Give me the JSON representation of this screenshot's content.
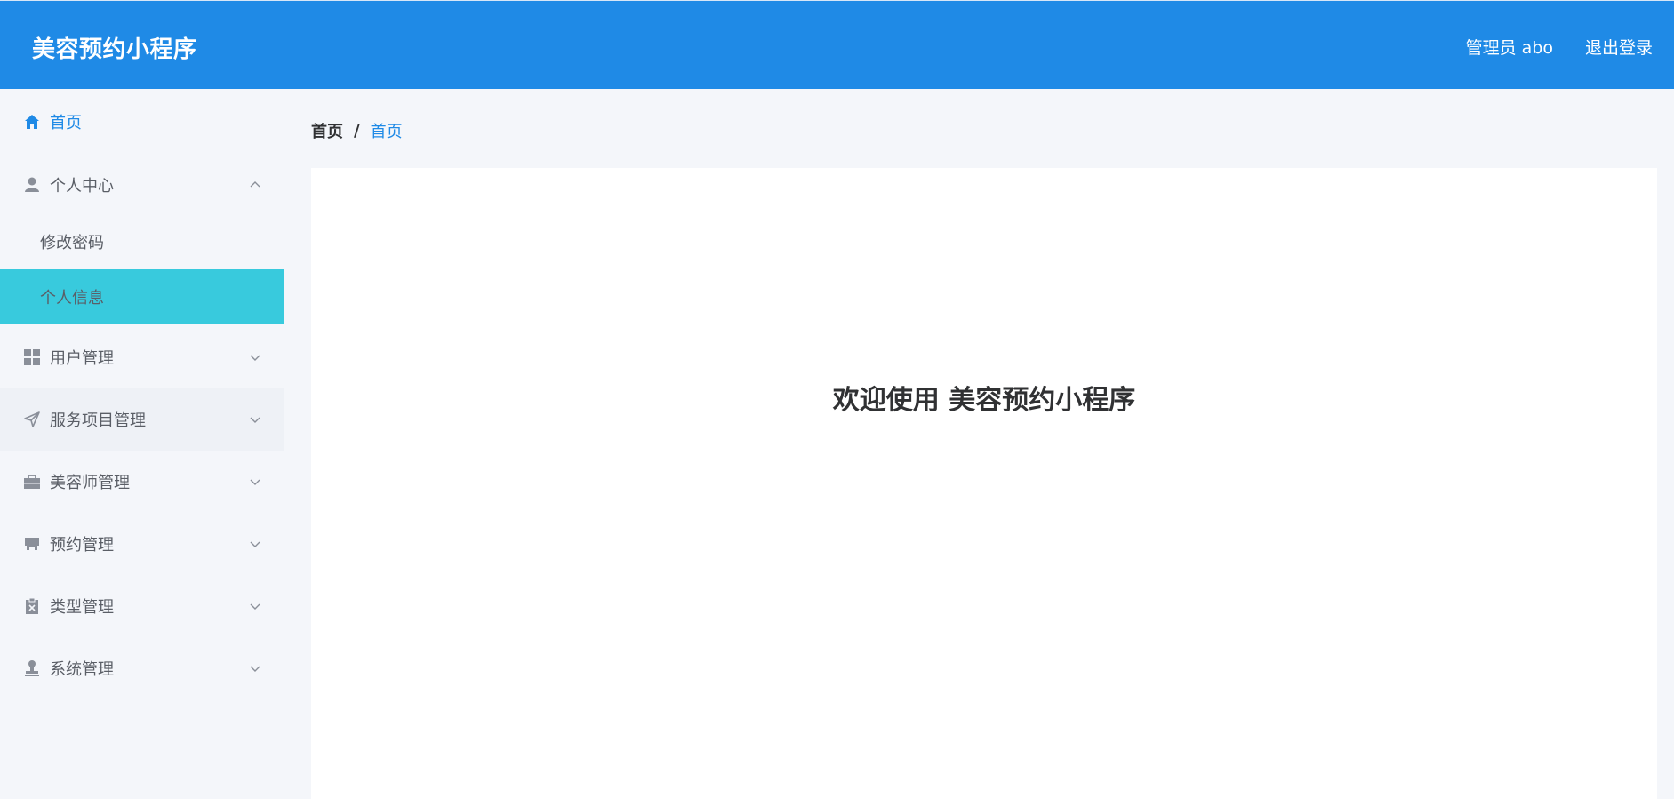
{
  "header": {
    "app_title": "美容预约小程序",
    "user_label": "管理员 abo",
    "logout_label": "退出登录",
    "background_color": "#1f8ae6"
  },
  "sidebar": {
    "items": [
      {
        "label": "首页",
        "icon": "home-icon",
        "active": true
      },
      {
        "label": "个人中心",
        "icon": "user-icon",
        "expanded": true,
        "children": [
          {
            "label": "修改密码"
          },
          {
            "label": "个人信息",
            "selected": true
          }
        ]
      },
      {
        "label": "用户管理",
        "icon": "grid-icon"
      },
      {
        "label": "服务项目管理",
        "icon": "send-icon"
      },
      {
        "label": "美容师管理",
        "icon": "briefcase-icon"
      },
      {
        "label": "预约管理",
        "icon": "shop-icon"
      },
      {
        "label": "类型管理",
        "icon": "clipboard-icon"
      },
      {
        "label": "系统管理",
        "icon": "stamp-icon"
      }
    ],
    "selected_color": "#38cadd",
    "accent_color": "#1f8ae6"
  },
  "breadcrumb": {
    "items": [
      "首页",
      "首页"
    ],
    "separator": "/"
  },
  "main": {
    "welcome_text": "欢迎使用 美容预约小程序"
  }
}
